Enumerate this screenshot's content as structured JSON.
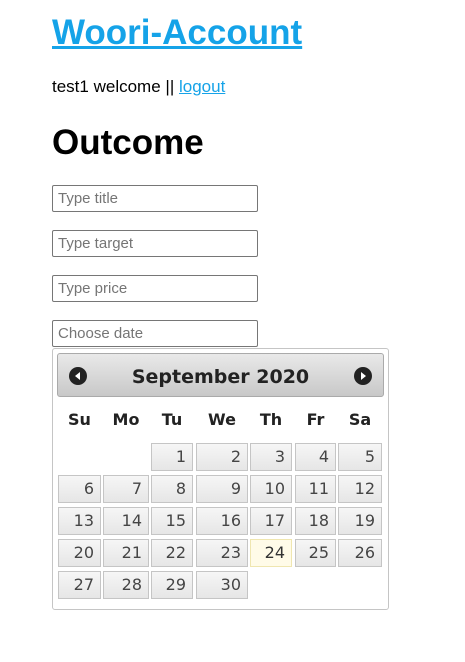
{
  "header": {
    "site_title": "Woori-Account",
    "user_name": "test1",
    "welcome_text": "welcome",
    "separator": "||",
    "logout_label": "logout"
  },
  "main": {
    "title": "Outcome",
    "fields": {
      "title_placeholder": "Type title",
      "target_placeholder": "Type target",
      "price_placeholder": "Type price",
      "date_placeholder": "Choose date"
    }
  },
  "datepicker": {
    "month_year": "September 2020",
    "prev_icon": "chevron-left-circle-icon",
    "next_icon": "chevron-right-circle-icon",
    "weekdays": [
      "Su",
      "Mo",
      "Tu",
      "We",
      "Th",
      "Fr",
      "Sa"
    ],
    "first_weekday_index": 2,
    "days_in_month": 30,
    "today": 24
  }
}
